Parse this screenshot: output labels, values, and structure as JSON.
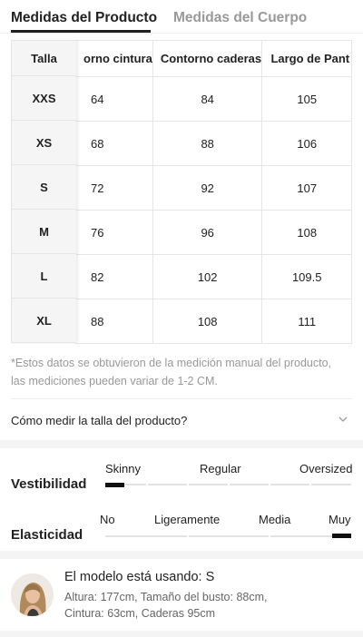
{
  "tabs": {
    "active": "Medidas del Producto",
    "inactive": "Medidas del Cuerpo"
  },
  "table": {
    "fixed_header": "Talla",
    "headers": [
      "orno cintura",
      "Contorno caderas",
      "Largo de Pant"
    ],
    "rows": [
      {
        "talla": "XXS",
        "cintura": "64",
        "caderas": "84",
        "largo": "105"
      },
      {
        "talla": "XS",
        "cintura": "68",
        "caderas": "88",
        "largo": "106"
      },
      {
        "talla": "S",
        "cintura": "72",
        "caderas": "92",
        "largo": "107"
      },
      {
        "talla": "M",
        "cintura": "76",
        "caderas": "96",
        "largo": "108"
      },
      {
        "talla": "L",
        "cintura": "82",
        "caderas": "102",
        "largo": "109.5"
      },
      {
        "talla": "XL",
        "cintura": "88",
        "caderas": "108",
        "largo": "111"
      }
    ]
  },
  "note": {
    "line1": "*Estos datos se obtuvieron de la medición manual del producto,",
    "line2": "las mediciones pueden variar de 1-2 CM."
  },
  "measure_link": "Cómo medir la talla del producto?",
  "fit": {
    "title": "Vestibilidad",
    "options": [
      "Skinny",
      "Regular",
      "Oversized"
    ],
    "selected": "Skinny"
  },
  "elasticity": {
    "title": "Elasticidad",
    "options": [
      "No",
      "Ligeramente",
      "Media",
      "Muy"
    ],
    "selected": "Muy"
  },
  "model": {
    "title": "El modelo está usando: S",
    "line1": "Altura: 177cm,  Tamaño del busto: 88cm,",
    "line2": "Cintura: 63cm,  Caderas 95cm"
  },
  "colors": {
    "text": "#222222",
    "muted": "#999999",
    "marker": "#111111",
    "band": "#f4f4f4"
  }
}
